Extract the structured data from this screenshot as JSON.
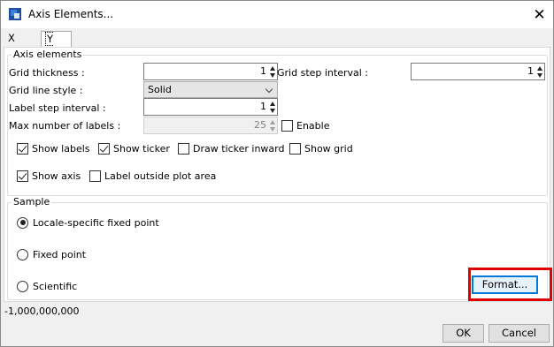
{
  "window": {
    "title": "Axis Elements...",
    "app_icon": "app-icon",
    "close_icon": "close-icon",
    "close_glyph": "✕"
  },
  "tabs": [
    {
      "label": "X axis",
      "selected": false
    },
    {
      "label": "Y axis",
      "selected": true
    }
  ],
  "axis_elements": {
    "title": "Axis elements",
    "grid_thickness": {
      "label": "Grid thickness :",
      "value": "1"
    },
    "grid_step_interval": {
      "label": "Grid step interval :",
      "value": "1"
    },
    "grid_line_style": {
      "label": "Grid line style :",
      "value": "Solid"
    },
    "label_step_interval": {
      "label": "Label step interval :",
      "value": "1"
    },
    "max_labels": {
      "label": "Max number of labels :",
      "value": "25",
      "disabled": true
    },
    "enable": {
      "label": "Enable",
      "checked": false
    },
    "checkboxes": {
      "show_labels": {
        "label": "Show labels",
        "checked": true
      },
      "show_ticker": {
        "label": "Show ticker",
        "checked": true
      },
      "draw_ticker_inward": {
        "label": "Draw ticker inward",
        "checked": false
      },
      "show_grid": {
        "label": "Show grid",
        "checked": false
      },
      "show_axis": {
        "label": "Show axis",
        "checked": true
      },
      "label_outside": {
        "label": "Label outside plot area",
        "checked": false
      }
    }
  },
  "sample": {
    "title": "Sample",
    "options": {
      "locale": {
        "label": "Locale-specific fixed point",
        "selected": true
      },
      "fixed": {
        "label": "Fixed point",
        "selected": false
      },
      "scientific": {
        "label": "Scientific",
        "selected": false
      }
    },
    "format_button": "Format...",
    "value": "-1,000,000,000"
  },
  "footer": {
    "ok": "OK",
    "cancel": "Cancel"
  },
  "colors": {
    "highlight": "#e00000",
    "default_button_border": "#0078d7"
  }
}
